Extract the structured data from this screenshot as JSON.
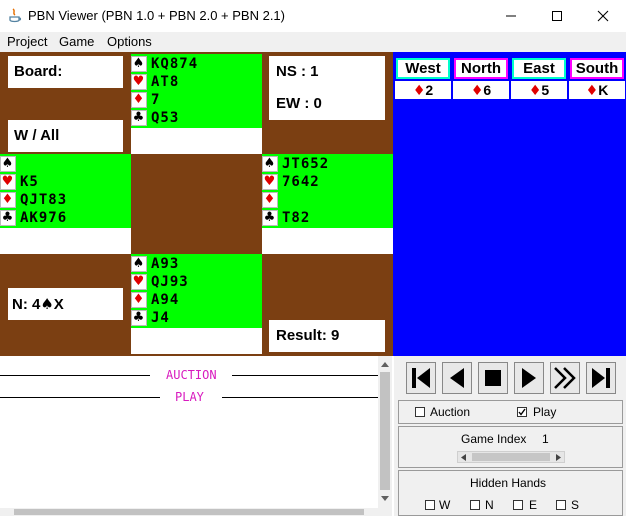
{
  "window": {
    "title": "PBN Viewer (PBN 1.0 + PBN 2.0 + PBN 2.1)"
  },
  "menu": [
    "Project",
    "Game",
    "Options"
  ],
  "board_info": {
    "board_label": "Board:",
    "vulnerability": "W / All",
    "contract_prefix": "N: 4",
    "contract_suffix": "X",
    "ns_score": "NS : 1",
    "ew_score": "EW : 0",
    "result": "Result: 9"
  },
  "hands": {
    "north": {
      "spades": "KQ874",
      "hearts": "AT8",
      "diamonds": "7",
      "clubs": "Q53"
    },
    "west": {
      "spades": "",
      "hearts": "K5",
      "diamonds": "QJT83",
      "clubs": "AK976"
    },
    "east": {
      "spades": "JT652",
      "hearts": "7642",
      "diamonds": "",
      "clubs": "T82"
    },
    "south": {
      "spades": "A93",
      "hearts": "QJ93",
      "diamonds": "A94",
      "clubs": "J4"
    }
  },
  "trick": {
    "players": [
      "West",
      "North",
      "East",
      "South"
    ],
    "cards": [
      "2",
      "6",
      "5",
      "K"
    ]
  },
  "text_area": {
    "auction_caption": "AUCTION",
    "play_caption": "PLAY"
  },
  "controls": {
    "auction_label": "Auction",
    "auction_checked": false,
    "play_label": "Play",
    "play_checked": true,
    "game_index_label": "Game Index",
    "game_index_value": "1",
    "hidden_hands_label": "Hidden Hands",
    "hidden_hands": [
      "W",
      "N",
      "E",
      "S"
    ]
  },
  "colors": {
    "board": "#7b3f12",
    "hand": "#00ff00",
    "trick_panel": "#0000ff",
    "caption": "#d81bbf",
    "red_suit": "#e00000"
  }
}
